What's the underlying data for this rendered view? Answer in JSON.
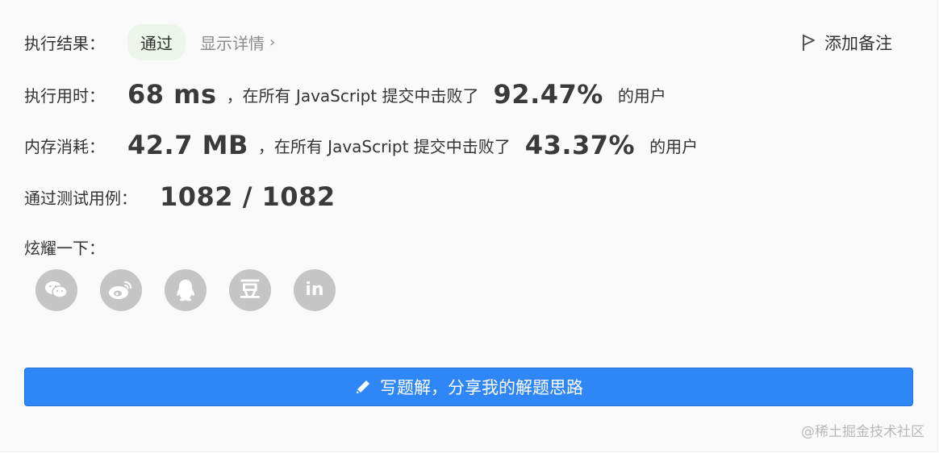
{
  "result": {
    "label": "执行结果：",
    "status": "通过",
    "detail_link": "显示详情",
    "note_button": "添加备注"
  },
  "runtime": {
    "label": "执行用时：",
    "value": "68 ms",
    "prefix": "，在所有 JavaScript 提交中击败了",
    "percent": "92.47%",
    "suffix": "的用户"
  },
  "memory": {
    "label": "内存消耗：",
    "value": "42.7 MB",
    "prefix": "，在所有 JavaScript 提交中击败了",
    "percent": "43.37%",
    "suffix": "的用户"
  },
  "tests": {
    "label": "通过测试用例：",
    "value": "1082 / 1082"
  },
  "share": {
    "label": "炫耀一下：",
    "icons": [
      "wechat-icon",
      "weibo-icon",
      "qq-icon",
      "douban-icon",
      "linkedin-icon"
    ],
    "douban_glyph": "豆",
    "linkedin_glyph": "in"
  },
  "cta": {
    "label": "写题解，分享我的解题思路"
  },
  "watermark": "@稀土掘金技术社区",
  "colors": {
    "accent": "#2f86f6",
    "status_bg": "#eef5ea",
    "icon_gray": "#c5c5c5"
  }
}
